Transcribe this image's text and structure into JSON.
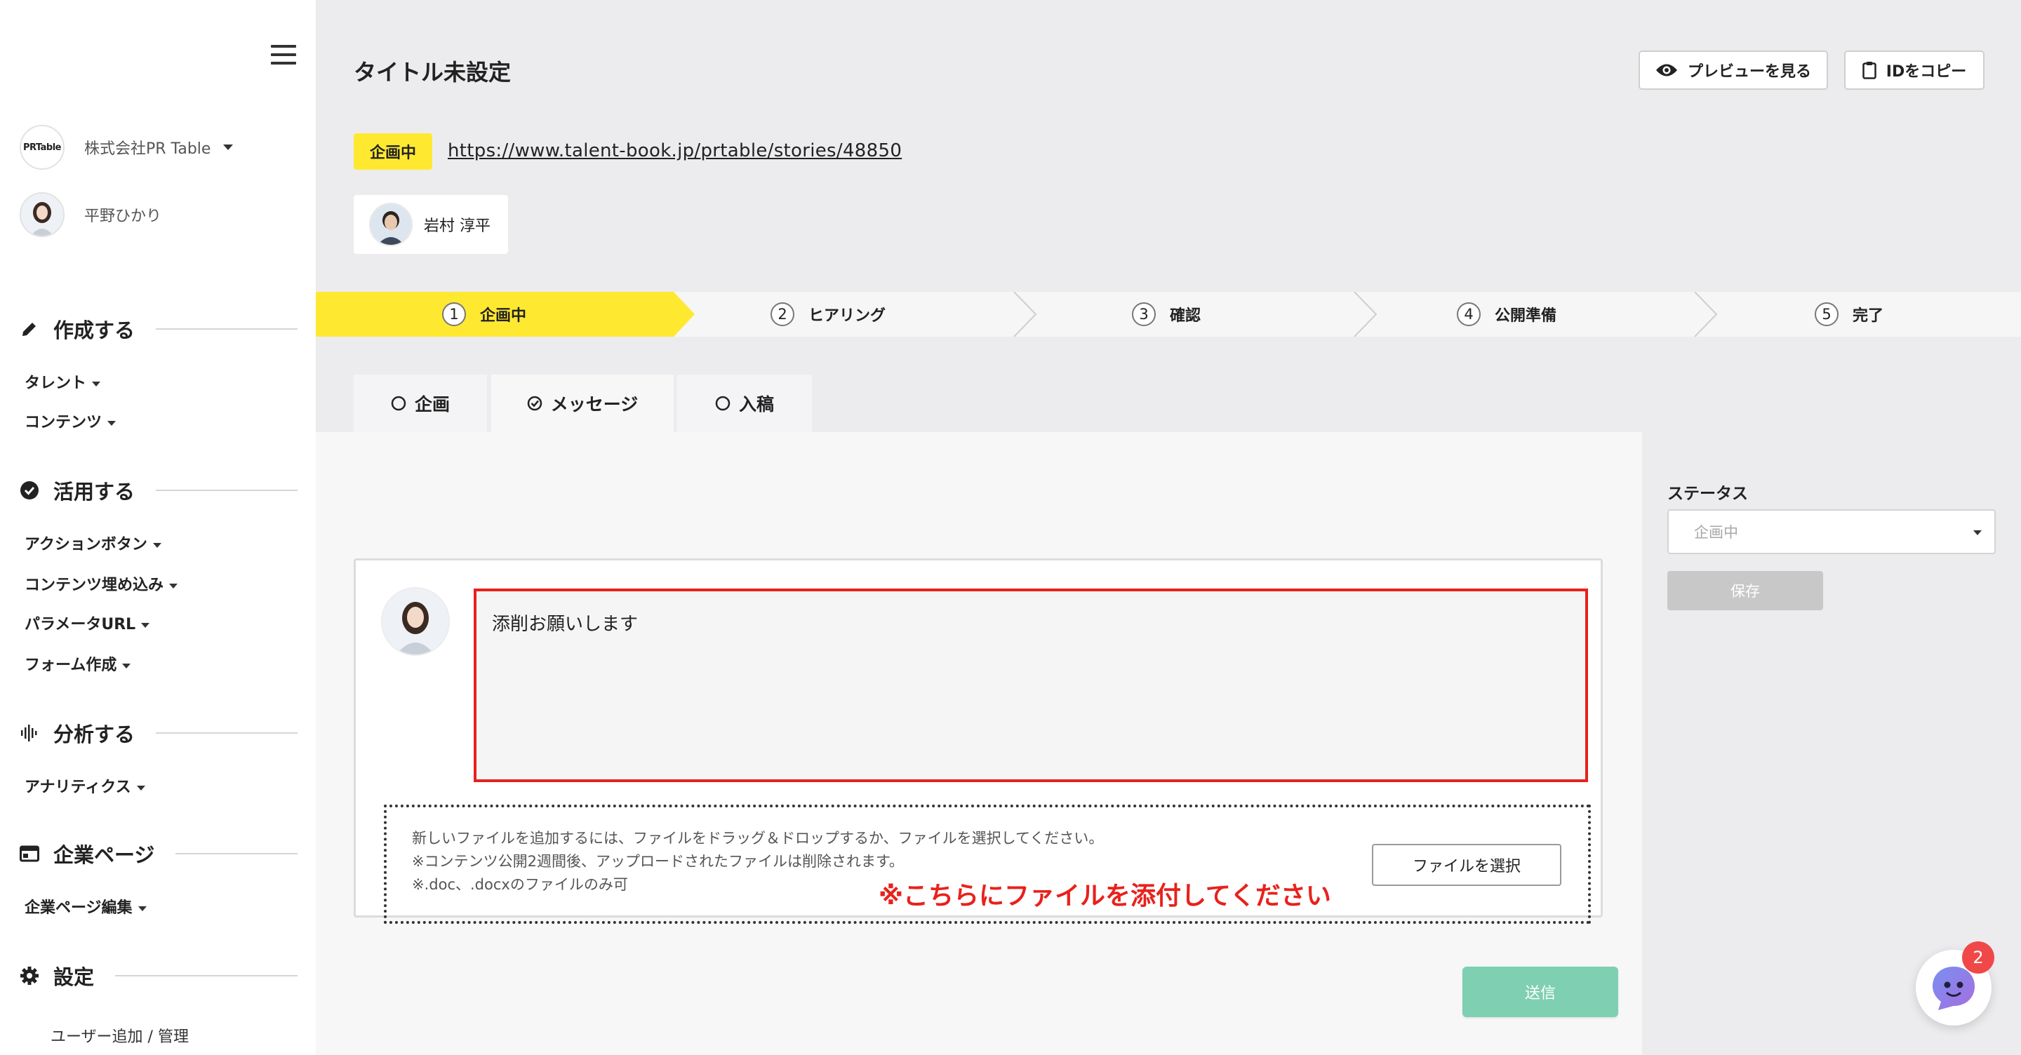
{
  "sidebar": {
    "company": "株式会社PR Table",
    "company_logo": "PRTable",
    "user_name": "平野ひかり",
    "sections": {
      "create": {
        "title": "作成する",
        "items": [
          "タレント",
          "コンテンツ"
        ]
      },
      "use": {
        "title": "活用する",
        "items": [
          "アクションボタン",
          "コンテンツ埋め込み",
          "パラメータURL",
          "フォーム作成"
        ]
      },
      "analyze": {
        "title": "分析する",
        "items": [
          "アナリティクス"
        ]
      },
      "company_page": {
        "title": "企業ページ",
        "items": [
          "企業ページ編集"
        ]
      },
      "settings": {
        "title": "設定",
        "items": [
          "ユーザー追加 / 管理"
        ]
      }
    }
  },
  "header": {
    "title": "タイトル未設定",
    "preview_label": "プレビューを見る",
    "copy_id_label": "IDをコピー",
    "status_badge": "企画中",
    "url": "https://www.talent-book.jp/prtable/stories/48850",
    "assignee": "岩村 淳平"
  },
  "steps": [
    {
      "num": "1",
      "label": "企画中",
      "active": true
    },
    {
      "num": "2",
      "label": "ヒアリング",
      "active": false
    },
    {
      "num": "3",
      "label": "確認",
      "active": false
    },
    {
      "num": "4",
      "label": "公開準備",
      "active": false
    },
    {
      "num": "5",
      "label": "完了",
      "active": false
    }
  ],
  "tabs": [
    {
      "label": "企画",
      "icon": "circle-icon"
    },
    {
      "label": "メッセージ",
      "icon": "check-circle-icon"
    },
    {
      "label": "入稿",
      "icon": "circle-icon"
    }
  ],
  "side_panel": {
    "status_label": "ステータス",
    "status_value": "企画中",
    "save_label": "保存"
  },
  "message": {
    "text": "添削お願いします",
    "upload_lines": [
      "新しいファイルを追加するには、ファイルをドラッグ＆ドロップするか、ファイルを選択してください。",
      "※コンテンツ公開2週間後、アップロードされたファイルは削除されます。",
      "※.doc、.docxのファイルのみ可"
    ],
    "select_file_label": "ファイルを選択",
    "annotation": "※こちらにファイルを添付してください",
    "send_label": "送信"
  },
  "chat": {
    "badge_count": "2"
  },
  "colors": {
    "accent_yellow": "#ffe930",
    "annotation_red": "#e8211c",
    "send_green": "#7fcfb2",
    "badge_red": "#f04848"
  }
}
